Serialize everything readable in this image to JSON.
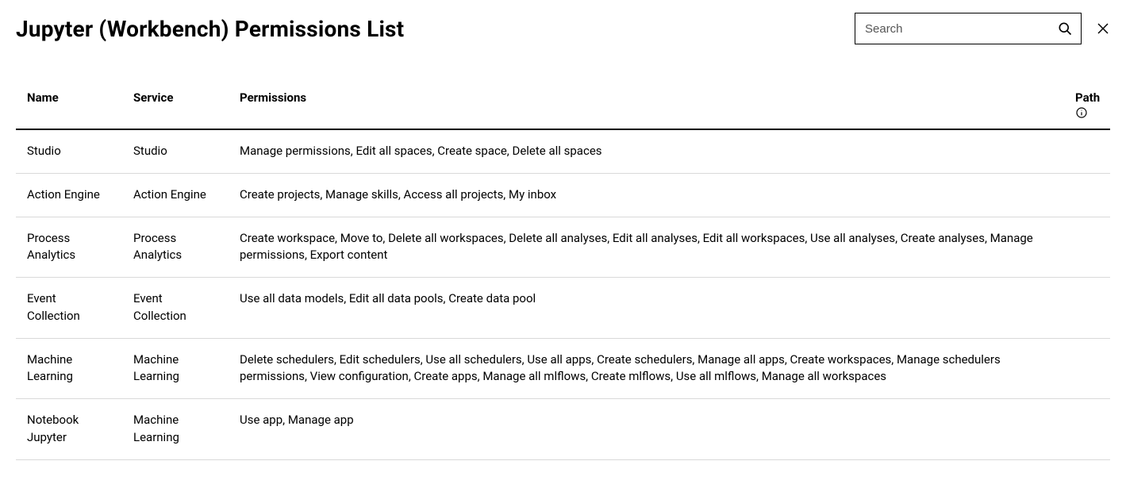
{
  "header": {
    "title": "Jupyter (Workbench) Permissions List"
  },
  "search": {
    "placeholder": "Search",
    "value": ""
  },
  "table": {
    "columns": {
      "name": "Name",
      "service": "Service",
      "permissions": "Permissions",
      "path": "Path"
    },
    "rows": [
      {
        "name": "Studio",
        "service": "Studio",
        "permissions": "Manage permissions, Edit all spaces, Create space, Delete all spaces"
      },
      {
        "name": "Action Engine",
        "service": "Action Engine",
        "permissions": "Create projects, Manage skills, Access all projects, My inbox"
      },
      {
        "name": "Process Analytics",
        "service": "Process Analytics",
        "permissions": "Create workspace, Move to, Delete all workspaces, Delete all analyses, Edit all analyses, Edit all workspaces, Use all analyses, Create analyses, Manage permissions, Export content"
      },
      {
        "name": "Event Collection",
        "service": "Event Collection",
        "permissions": "Use all data models, Edit all data pools, Create data pool"
      },
      {
        "name": "Machine Learning",
        "service": "Machine Learning",
        "permissions": "Delete schedulers, Edit schedulers, Use all schedulers, Use all apps, Create schedulers, Manage all apps, Create workspaces, Manage schedulers permissions, View configuration, Create apps, Manage all mlflows, Create mlflows, Use all mlflows, Manage all workspaces"
      },
      {
        "name": "Notebook Jupyter",
        "service": "Machine Learning",
        "permissions": "Use app, Manage app"
      }
    ]
  }
}
